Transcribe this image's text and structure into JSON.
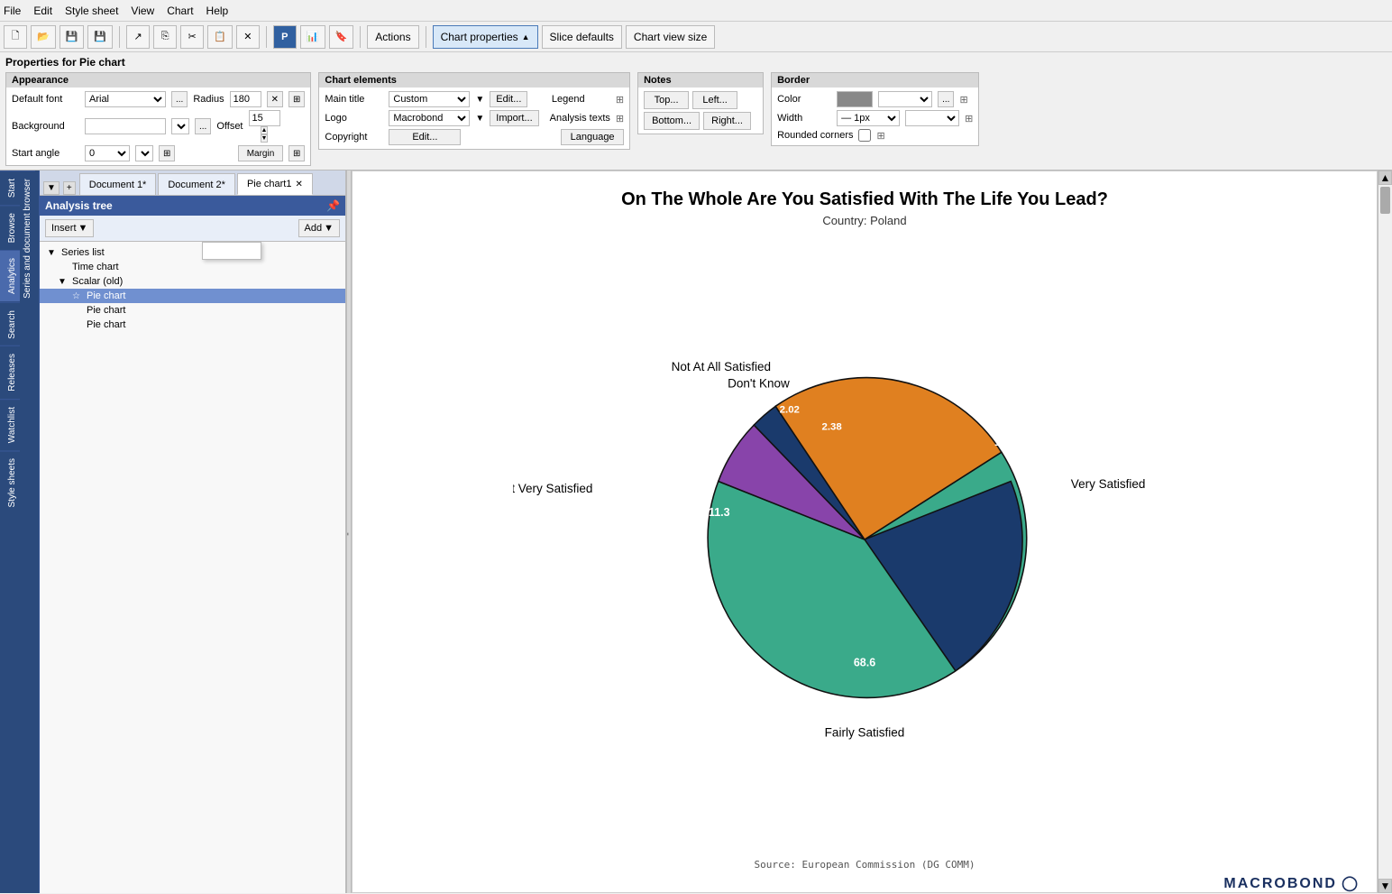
{
  "menu": {
    "items": [
      "File",
      "Edit",
      "Style sheet",
      "View",
      "Chart",
      "Help"
    ]
  },
  "toolbar": {
    "actions_label": "Actions",
    "chart_properties_label": "Chart properties",
    "slice_defaults_label": "Slice defaults",
    "chart_view_size_label": "Chart view size"
  },
  "properties": {
    "title": "Properties for Pie chart",
    "appearance_title": "Appearance",
    "default_font_label": "Default font",
    "default_font_value": "Arial",
    "background_label": "Background",
    "start_angle_label": "Start angle",
    "start_angle_value": "0",
    "radius_label": "Radius",
    "radius_value": "180",
    "offset_label": "Offset",
    "offset_value": "15",
    "margin_label": "Margin"
  },
  "chart_elements": {
    "title": "Chart elements",
    "main_title_label": "Main title",
    "main_title_value": "Custom",
    "edit_label": "Edit...",
    "legend_label": "Legend",
    "logo_label": "Logo",
    "logo_value": "Macrobond",
    "import_label": "Import...",
    "analysis_texts_label": "Analysis texts",
    "copyright_label": "Copyright",
    "edit2_label": "Edit...",
    "language_label": "Language"
  },
  "notes": {
    "title": "Notes",
    "top_label": "Top...",
    "left_label": "Left...",
    "bottom_label": "Bottom...",
    "right_label": "Right..."
  },
  "border": {
    "title": "Border",
    "color_label": "Color",
    "width_label": "Width",
    "width_value": "— 1px",
    "rounded_corners_label": "Rounded corners"
  },
  "tabs": {
    "items": [
      "Document 1*",
      "Document 2*",
      "Pie chart1"
    ]
  },
  "analysis_tree": {
    "title": "Analysis tree",
    "insert_label": "Insert",
    "add_label": "Add",
    "tree_items": [
      {
        "label": "Series list",
        "level": 0,
        "expandable": true,
        "expanded": true
      },
      {
        "label": "Time chart",
        "level": 1,
        "expandable": false
      },
      {
        "label": "Scalar (old)",
        "level": 1,
        "expandable": true,
        "expanded": true
      },
      {
        "label": "Pie chart",
        "level": 2,
        "expandable": false,
        "active": true
      },
      {
        "label": "Pie chart",
        "level": 2,
        "expandable": false
      },
      {
        "label": "Pie chart",
        "level": 2,
        "expandable": false
      }
    ],
    "series_list_tooltip": "Series list"
  },
  "sidebar_tabs": [
    "Start",
    "Browse",
    "Analytics",
    "Search",
    "Releases",
    "Watchlist",
    "Style sheets"
  ],
  "chart": {
    "title": "On The Whole Are You Satisfied With The Life You Lead?",
    "subtitle": "Country: Poland",
    "source": "Source: European Commission (DG COMM)",
    "logo": "MACROBOND",
    "slices": [
      {
        "label": "Very Satisfied",
        "value": 15.6,
        "color": "#1a3a6c",
        "startAngle": -30,
        "endAngle": 56
      },
      {
        "label": "Fairly Satisfied",
        "value": 68.6,
        "color": "#3aaa8a",
        "startAngle": 56,
        "endAngle": 303
      },
      {
        "label": "Not Very Satisfied",
        "value": 11.3,
        "color": "#8844aa",
        "startAngle": 303,
        "endAngle": 349
      },
      {
        "label": "Don't Know",
        "value": 2.38,
        "color": "#1a3a6c",
        "startAngle": 349,
        "endAngle": 358
      },
      {
        "label": "Not At All Satisfied",
        "value": 2.02,
        "color": "#e08020",
        "startAngle": 358,
        "endAngle": 366
      }
    ]
  }
}
